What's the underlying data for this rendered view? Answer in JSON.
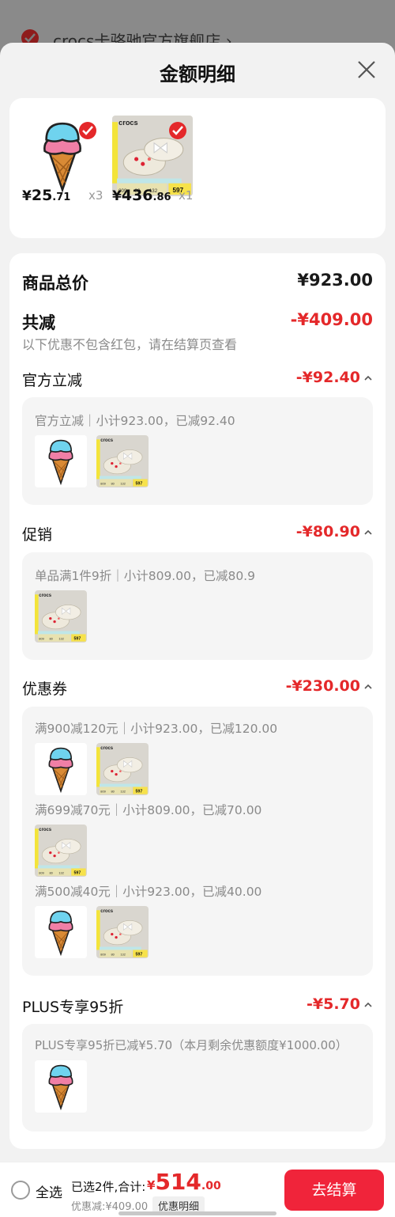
{
  "store": {
    "name": "crocs卡骆驰官方旗舰店 ›"
  },
  "sheet": {
    "title": "金额明细"
  },
  "products": [
    {
      "price_cur": "¥",
      "price_int": "25",
      "price_dec": ".71",
      "qty": "x3",
      "image": "ice-cream-charm",
      "selected": true
    },
    {
      "price_cur": "¥",
      "price_int": "436",
      "price_dec": ".86",
      "qty": "x1",
      "image": "crocs-clog",
      "selected": true
    }
  ],
  "summary": {
    "total_label": "商品总价",
    "total_value": "¥923.00",
    "reduce_label": "共减",
    "reduce_value": "-¥409.00",
    "note": "以下优惠不包含红包，请在结算页查看"
  },
  "discounts": [
    {
      "label": "官方立减",
      "value": "-¥92.40",
      "groups": [
        {
          "text": "官方立减｜小计923.00，已减92.40",
          "items": [
            "ice-cream-charm",
            "crocs-clog"
          ]
        }
      ]
    },
    {
      "label": "促销",
      "value": "-¥80.90",
      "groups": [
        {
          "text": "单品满1件9折｜小计809.00，已减80.9",
          "items": [
            "crocs-clog"
          ]
        }
      ]
    },
    {
      "label": "优惠券",
      "value": "-¥230.00",
      "groups": [
        {
          "text": "满900减120元｜小计923.00，已减120.00",
          "items": [
            "ice-cream-charm",
            "crocs-clog"
          ]
        },
        {
          "text": "满699减70元｜小计809.00，已减70.00",
          "items": [
            "crocs-clog"
          ]
        },
        {
          "text": "满500减40元｜小计923.00，已减40.00",
          "items": [
            "ice-cream-charm",
            "crocs-clog"
          ]
        }
      ]
    },
    {
      "label": "PLUS专享95折",
      "value": "-¥5.70",
      "groups": [
        {
          "text": "PLUS专享95折已减¥5.70（本月剩余优惠额度¥1000.00）",
          "items": [
            "ice-cream-charm"
          ]
        }
      ]
    }
  ],
  "bottom": {
    "select_all": "全选",
    "selected_info": "已选2件,合计:",
    "total_cur": "¥",
    "total_int": "514",
    "total_dec": ".00",
    "discount_line": "优惠减:¥409.00",
    "detail_btn": "优惠明细",
    "checkout": "去结算"
  },
  "clog_label": {
    "brand": "crocs",
    "badge": "597",
    "stats": [
      "809",
      "80",
      "132"
    ]
  },
  "colors": {
    "accent_red": "#e4282a",
    "checkout_red": "#f0243a",
    "cone": "#d98a35",
    "scoop_blue": "#6fd3ee",
    "scoop_pink": "#f07fa6"
  }
}
